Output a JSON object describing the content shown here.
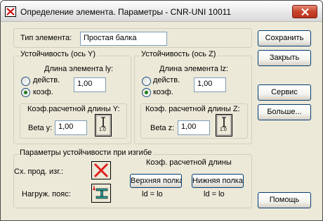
{
  "window": {
    "title": "Определение элемента. Параметры - CNR-UNI 10011",
    "close_icon": "close-icon"
  },
  "element_type": {
    "label": "Тип элемента:",
    "value": "Простая балка"
  },
  "stability_y": {
    "legend": "Устойчивость (ось Y)",
    "length_label": "Длина элемента ly:",
    "option_actual": "действ.",
    "option_coef": "коэф.",
    "selected": "коэф.",
    "value": "1,00",
    "calc_group": "Коэф.расчетной длины Y:",
    "beta_label": "Beta y:",
    "beta_value": "1,00",
    "icon_label": "1.0"
  },
  "stability_z": {
    "legend": "Устойчивость (ось Z)",
    "length_label": "Длина элемента lz:",
    "option_actual": "действ.",
    "option_coef": "коэф.",
    "selected": "коэф.",
    "value": "1,00",
    "calc_group": "Коэф. расчетной длины Z:",
    "beta_label": "Beta z:",
    "beta_value": "1,00",
    "icon_label": "1.0"
  },
  "bending": {
    "legend": "Параметры устойчивости при изгибе",
    "prod_label": "Сх. прод. изг.:",
    "load_label": "Нагруж. пояс:",
    "coef_label": "Коэф. расчетной длины",
    "upper_button": "Верхняя полка",
    "lower_button": "Нижняя полка",
    "upper_formula": "ld = lo",
    "lower_formula": "ld = lo"
  },
  "buttons": {
    "save": "Сохранить",
    "close": "Закрыть",
    "service": "Сервис",
    "more": "Больше...",
    "help": "Помощь"
  },
  "colors": {
    "window_bg": "#ece9d8",
    "close_red": "#c7442a",
    "x_icon_red": "#e31e1e",
    "beam_teal": "#2aa198"
  }
}
